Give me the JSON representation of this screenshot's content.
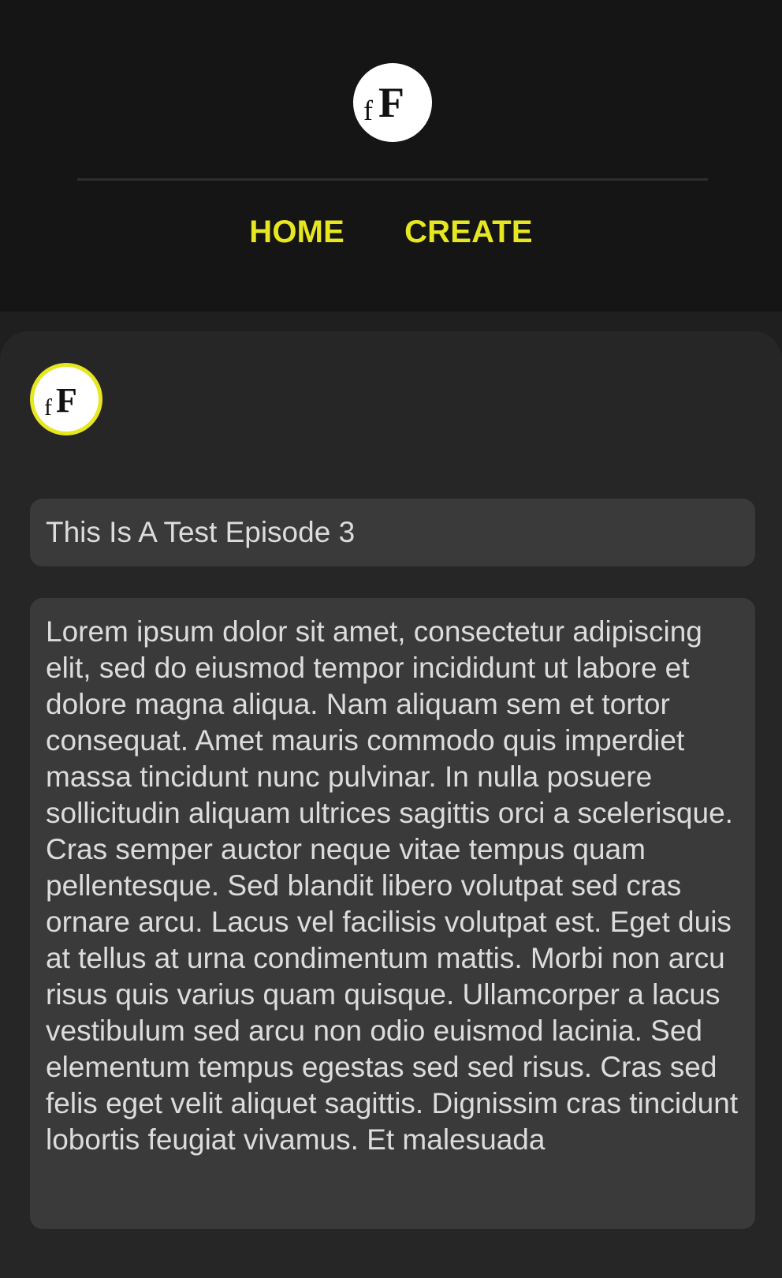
{
  "header": {
    "logo_icon": "fF-logo-icon",
    "nav": {
      "home_label": "HOME",
      "create_label": "CREATE"
    }
  },
  "episode": {
    "avatar_icon": "fF-logo-avatar-icon",
    "title_value": "This Is A Test Episode 3",
    "body_value": "Lorem ipsum dolor sit amet, consectetur adipiscing elit, sed do eiusmod tempor incididunt ut labore et dolore magna aliqua. Nam aliquam sem et tortor consequat. Amet mauris commodo quis imperdiet massa tincidunt nunc pulvinar. In nulla posuere sollicitudin aliquam ultrices sagittis orci a scelerisque. Cras semper auctor neque vitae tempus quam pellentesque. Sed blandit libero volutpat sed cras ornare arcu. Lacus vel facilisis volutpat est. Eget duis at tellus at urna condimentum mattis. Morbi non arcu risus quis varius quam quisque. Ullamcorper a lacus vestibulum sed arcu non odio euismod lacinia. Sed elementum tempus egestas sed sed risus. Cras sed felis eget velit aliquet sagittis. Dignissim cras tincidunt lobortis feugiat vivamus. Et malesuada"
  },
  "colors": {
    "accent": "#e6e621",
    "header_bg": "#151515",
    "card_bg": "#262626",
    "field_bg": "#3a3a3a",
    "text": "#dcdcdc"
  }
}
